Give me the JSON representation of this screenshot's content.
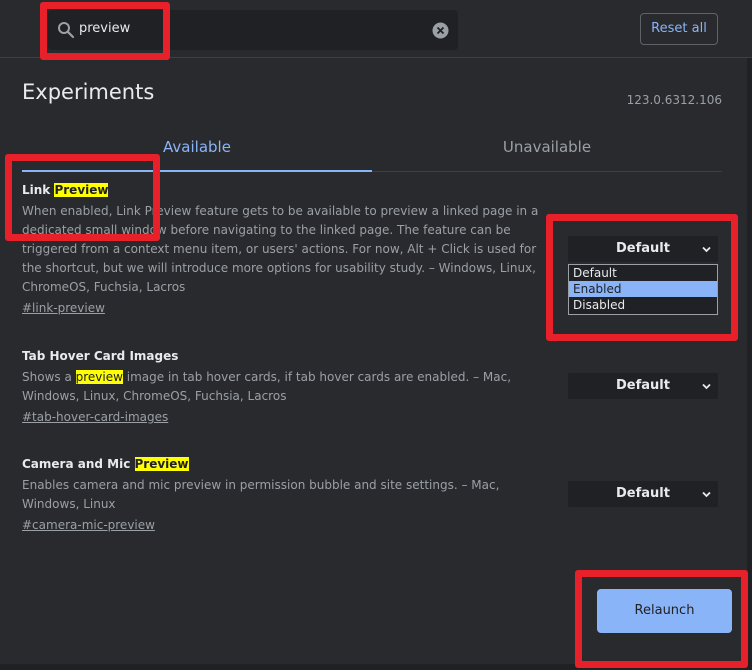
{
  "search": {
    "value": "preview"
  },
  "header": {
    "reset_label": "Reset all"
  },
  "page": {
    "title": "Experiments",
    "version": "123.0.6312.106"
  },
  "tabs": [
    {
      "label": "Available",
      "active": true
    },
    {
      "label": "Unavailable",
      "active": false
    }
  ],
  "experiments": [
    {
      "title_prefix": "Link ",
      "title_highlight": "Preview",
      "title_suffix": "",
      "desc_prefix": "",
      "desc_highlight": "",
      "desc_suffix": "When enabled, Link Preview feature gets to be available to preview a linked page in a dedicated small window before navigating to the linked page. The feature can be triggered from a context menu item, or users' actions. For now, Alt + Click is used for the shortcut, but we will introduce more options for usability study. – Windows, Linux, ChromeOS, Fuchsia, Lacros",
      "link": "#link-preview",
      "select_value": "Default",
      "options": [
        "Default",
        "Enabled",
        "Disabled"
      ],
      "highlighted_option": "Enabled"
    },
    {
      "title_prefix": "Tab Hover Card Images",
      "title_highlight": "",
      "title_suffix": "",
      "desc_prefix": "Shows a ",
      "desc_highlight": "preview",
      "desc_suffix": " image in tab hover cards, if tab hover cards are enabled. – Mac, Windows, Linux, ChromeOS, Fuchsia, Lacros",
      "link": "#tab-hover-card-images",
      "select_value": "Default"
    },
    {
      "title_prefix": "Camera and Mic ",
      "title_highlight": "Preview",
      "title_suffix": "",
      "desc_prefix": "",
      "desc_highlight": "",
      "desc_suffix": "Enables camera and mic preview in permission bubble and site settings. – Mac, Windows, Linux",
      "link": "#camera-mic-preview",
      "select_value": "Default"
    }
  ],
  "footer": {
    "relaunch_label": "Relaunch"
  },
  "colors": {
    "accent": "#8ab4f8",
    "background": "#292a2d",
    "highlight": "#ffff00",
    "annotation": "#e8202a"
  }
}
